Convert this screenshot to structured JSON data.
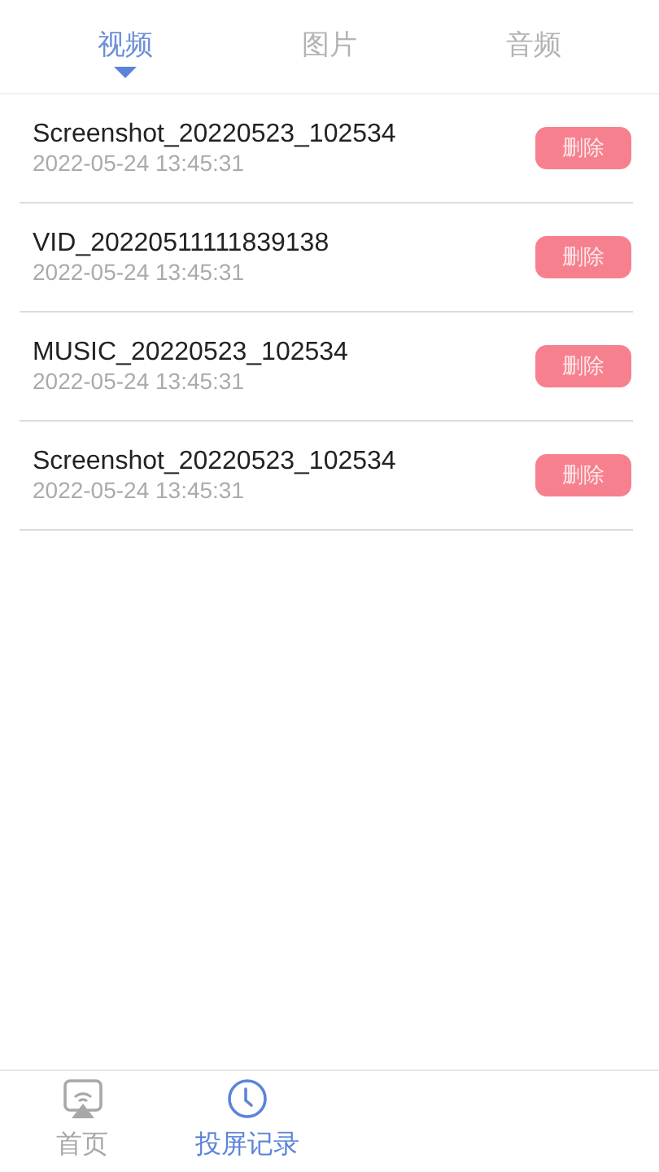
{
  "tabs": [
    {
      "label": "视频",
      "selected": true
    },
    {
      "label": "图片",
      "selected": false
    },
    {
      "label": "音频",
      "selected": false
    }
  ],
  "records": [
    {
      "name": "Screenshot_20220523_102534",
      "time": "2022-05-24  13:45:31",
      "action": "删除"
    },
    {
      "name": "VID_20220511111839138",
      "time": "2022-05-24  13:45:31",
      "action": "删除"
    },
    {
      "name": "MUSIC_20220523_102534",
      "time": "2022-05-24  13:45:31",
      "action": "删除"
    },
    {
      "name": "Screenshot_20220523_102534",
      "time": "2022-05-24  13:45:31",
      "action": "删除"
    }
  ],
  "bottom_nav": [
    {
      "label": "首页",
      "kind": "cast",
      "selected": false
    },
    {
      "label": "投屏记录",
      "kind": "clock",
      "selected": true
    }
  ]
}
